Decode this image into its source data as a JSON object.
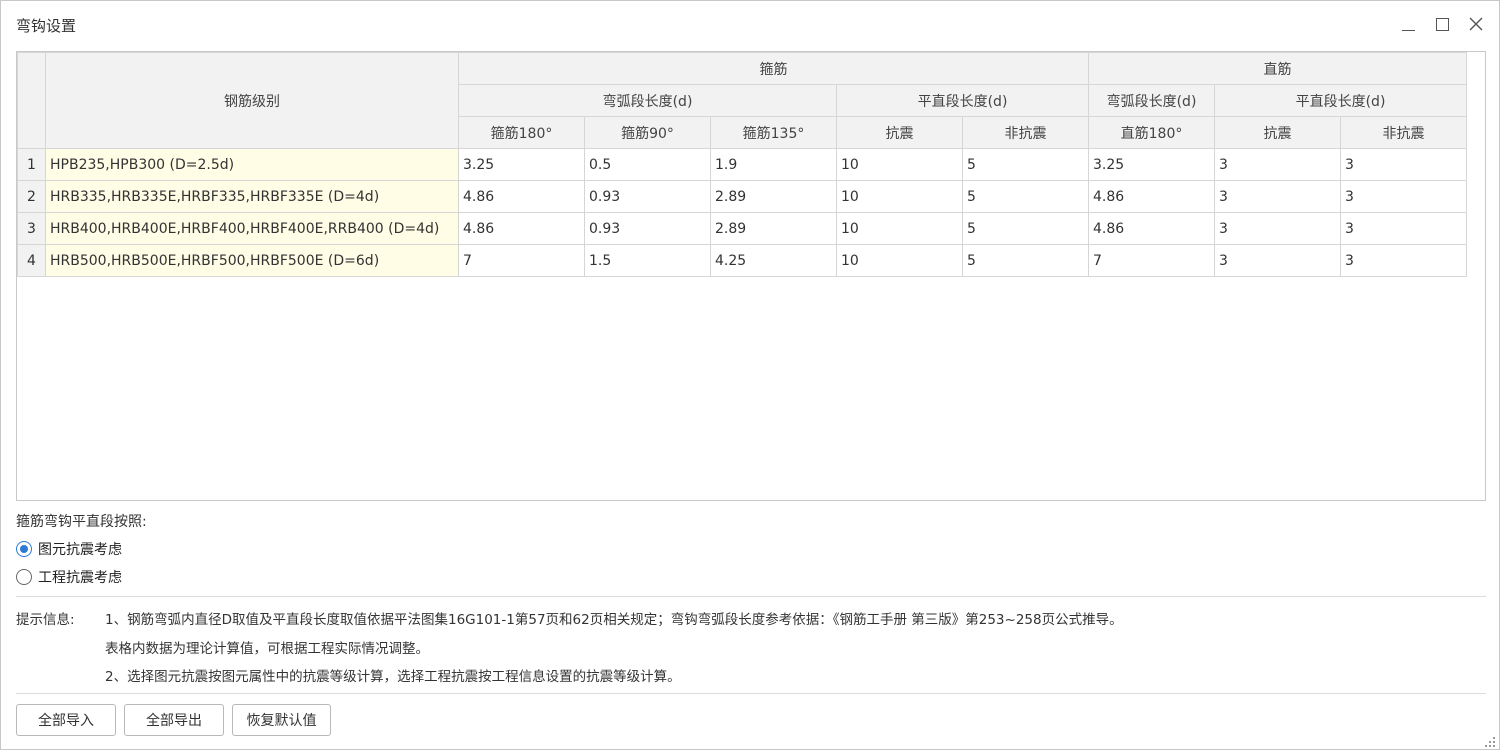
{
  "window": {
    "title": "弯钩设置"
  },
  "table": {
    "header": {
      "grade": "钢筋级别",
      "stirrup": "箍筋",
      "straight": "直筋",
      "arc_len": "弯弧段长度(d)",
      "flat_len": "平直段长度(d)",
      "straight_arc_len": "弯弧段长度(d)",
      "straight_flat_len": "平直段长度(d)",
      "s180": "箍筋180°",
      "s90": "箍筋90°",
      "s135": "箍筋135°",
      "seismic": "抗震",
      "nonseismic": "非抗震",
      "z180": "直筋180°",
      "z_seismic": "抗震",
      "z_nonseismic": "非抗震"
    },
    "rows": [
      [
        "1",
        "HPB235,HPB300 (D=2.5d)",
        "3.25",
        "0.5",
        "1.9",
        "10",
        "5",
        "3.25",
        "3",
        "3"
      ],
      [
        "2",
        "HRB335,HRB335E,HRBF335,HRBF335E (D=4d)",
        "4.86",
        "0.93",
        "2.89",
        "10",
        "5",
        "4.86",
        "3",
        "3"
      ],
      [
        "3",
        "HRB400,HRB400E,HRBF400,HRBF400E,RRB400 (D=4d)",
        "4.86",
        "0.93",
        "2.89",
        "10",
        "5",
        "4.86",
        "3",
        "3"
      ],
      [
        "4",
        "HRB500,HRB500E,HRBF500,HRBF500E (D=6d)",
        "7",
        "1.5",
        "4.25",
        "10",
        "5",
        "7",
        "3",
        "3"
      ]
    ]
  },
  "options": {
    "label": "箍筋弯钩平直段按照:",
    "radio1": "图元抗震考虑",
    "radio2": "工程抗震考虑"
  },
  "tips": {
    "label": "提示信息:",
    "line1": "1、钢筋弯弧内直径D取值及平直段长度取值依据平法图集16G101-1第57页和62页相关规定；弯钩弯弧段长度参考依据：《钢筋工手册  第三版》第253~258页公式推导。",
    "line2": "表格内数据为理论计算值，可根据工程实际情况调整。",
    "line3": "2、选择图元抗震按图元属性中的抗震等级计算，选择工程抗震按工程信息设置的抗震等级计算。"
  },
  "buttons": {
    "import": "全部导入",
    "export": "全部导出",
    "restore": "恢复默认值"
  }
}
